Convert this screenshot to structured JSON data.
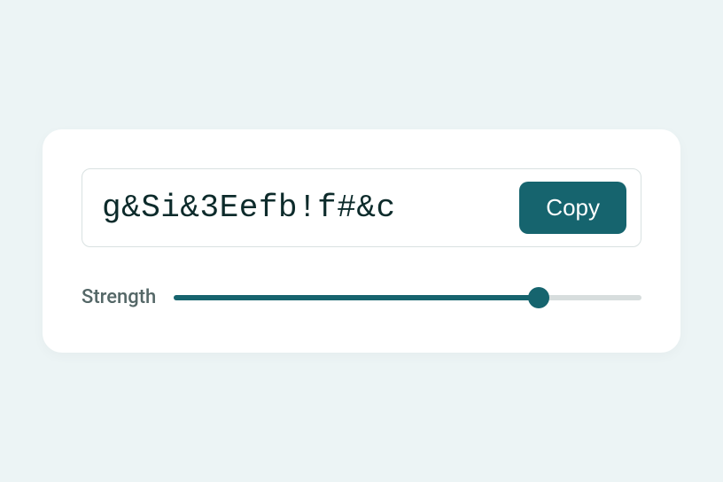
{
  "password": {
    "value": "g&Si&3Eefb!f#&c",
    "copy_label": "Copy"
  },
  "strength": {
    "label": "Strength",
    "percent": 78
  },
  "colors": {
    "accent": "#16646e",
    "page_bg": "#ecf4f5",
    "card_bg": "#ffffff"
  }
}
